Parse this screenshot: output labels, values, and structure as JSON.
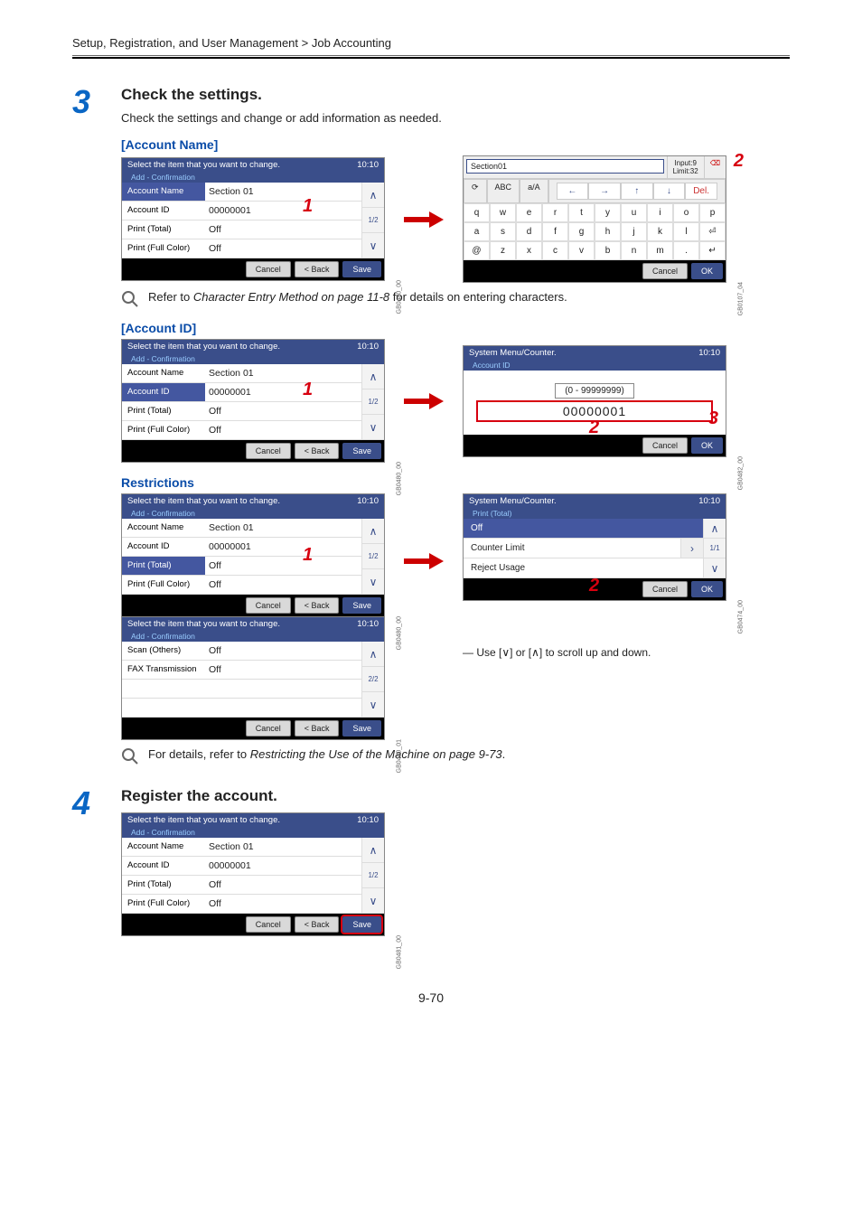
{
  "breadcrumb": "Setup, Registration, and User Management > Job Accounting",
  "step3": {
    "num": "3",
    "title": "Check the settings.",
    "desc": "Check the settings and change or add information as needed."
  },
  "sec_account_name": "[Account Name]",
  "sec_account_id": "[Account ID]",
  "sec_restrictions": "Restrictions",
  "lcd_select": "Select the item that you want to change.",
  "lcd_sub": "Add - Confirmation",
  "clock": "10:10",
  "rows": {
    "acct_name_lbl": "Account Name",
    "acct_name_val": "Section 01",
    "acct_id_lbl": "Account ID",
    "acct_id_val": "00000001",
    "pt_lbl": "Print (Total)",
    "pt_val": "Off",
    "pfc_lbl": "Print (Full Color)",
    "pfc_val": "Off",
    "scan_lbl": "Scan (Others)",
    "scan_val": "Off",
    "fax_lbl": "FAX Transmission",
    "fax_val": "Off"
  },
  "range": "(0 - 99999999)",
  "id_value": "00000001",
  "pager_half": "1/2",
  "pager_full": "2/2",
  "pager_one": "1/1",
  "buttons": {
    "cancel": "Cancel",
    "back": "< Back",
    "save": "Save",
    "ok": "OK"
  },
  "note_char_entry": "Refer to Character Entry Method on page 11-8 for details on entering characters.",
  "note_restrict": "For details, refer to Restricting the Use of the Machine on page 9-73.",
  "scroll_hint": "Use [∨] or [∧] to scroll up and down.",
  "sysmenu": "System Menu/Counter.",
  "sysmenu_sub_id": "Account ID",
  "sysmenu_sub_pt": "Print (Total)",
  "menu": {
    "off": "Off",
    "counter": "Counter Limit",
    "reject": "Reject Usage"
  },
  "kb": {
    "value": "Section01",
    "chip1": "Input:9",
    "chip2": "Limit:32",
    "mode_arrow": "⟳",
    "ABC": "ABC",
    "aa": "a/A",
    "r1": [
      "q",
      "w",
      "e",
      "r",
      "t",
      "y",
      "u",
      "i",
      "o",
      "p"
    ],
    "r2": [
      "a",
      "s",
      "d",
      "f",
      "g",
      "h",
      "j",
      "k",
      "l",
      "⏎"
    ],
    "r3": [
      "@",
      "z",
      "x",
      "c",
      "v",
      "b",
      "n",
      "m",
      ".",
      "↵"
    ]
  },
  "step4": {
    "num": "4",
    "title": "Register the account."
  },
  "footer_page": "9-70",
  "figcodes": {
    "a": "GB0480_00",
    "b": "GB0107_04",
    "c": "GB0480_00",
    "d": "GB0482_00",
    "e": "GB0480_00",
    "f": "GB0474_00",
    "g": "GB0480_01",
    "h": "GB0481_00"
  }
}
